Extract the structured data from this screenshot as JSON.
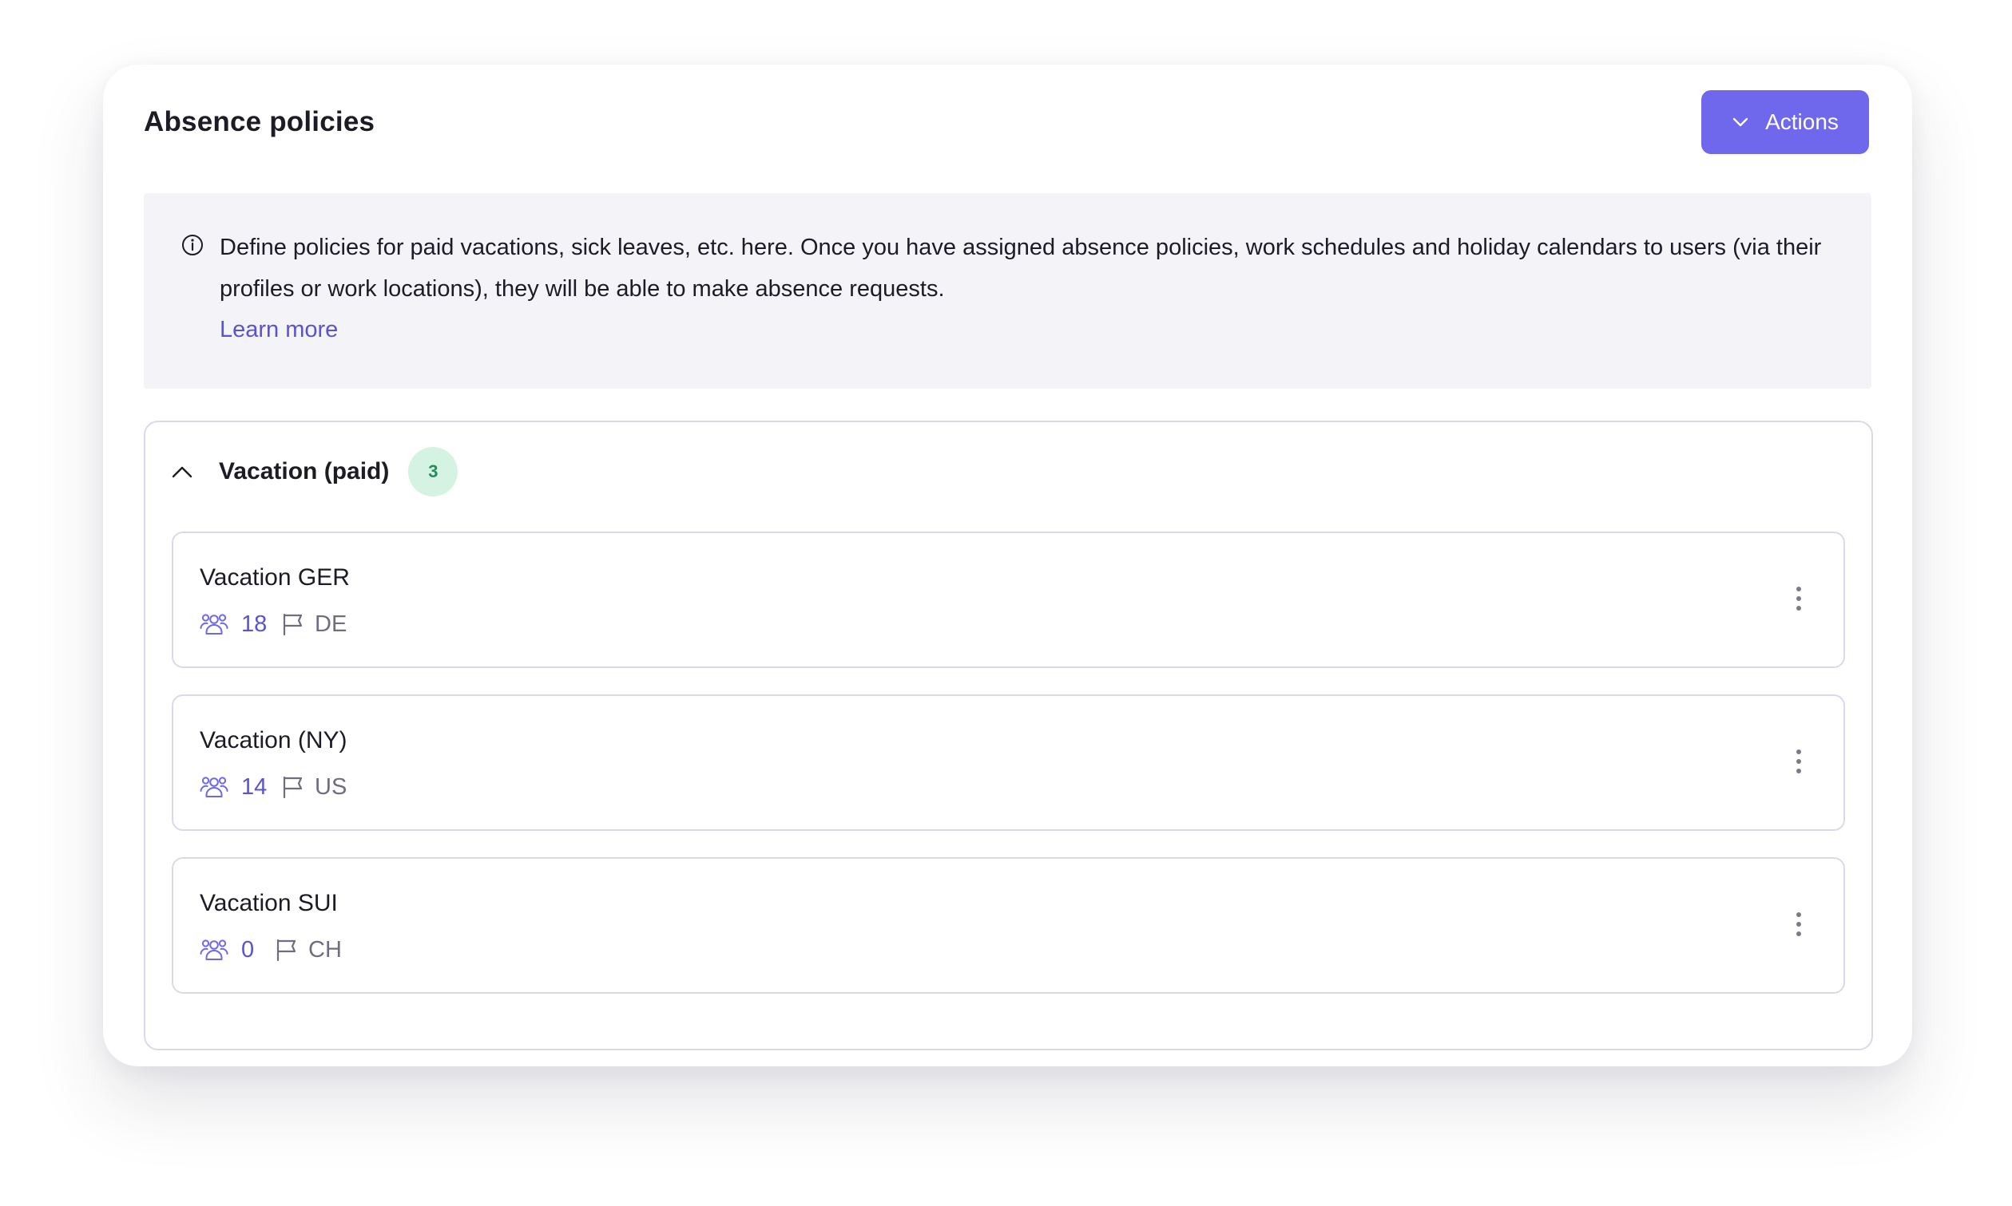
{
  "page": {
    "title": "Absence policies",
    "actions_label": "Actions"
  },
  "info": {
    "text": "Define policies for paid vacations, sick leaves, etc. here. Once you have assigned absence policies, work schedules and holiday calendars to users (via their profiles or work locations), they will be able to make absence requests.",
    "link_label": "Learn more",
    "icon": "info-icon"
  },
  "group": {
    "title": "Vacation (paid)",
    "count": "3",
    "expanded": true
  },
  "policies": [
    {
      "name": "Vacation GER",
      "members": "18",
      "country": "DE"
    },
    {
      "name": "Vacation (NY)",
      "members": "14",
      "country": "US"
    },
    {
      "name": "Vacation SUI",
      "members": "0",
      "country": "CH"
    }
  ],
  "colors": {
    "accent": "#6f67ec",
    "link": "#5a52d6",
    "badge_bg": "#d4f3e2",
    "badge_text": "#2b8a5b",
    "info_bg": "#f4f4f8",
    "border": "#d9d9ee"
  },
  "icons": {
    "people": "people-icon",
    "flag": "flag-icon",
    "more": "more-vertical-icon",
    "chevron_up": "chevron-up-icon",
    "chevron_down": "chevron-down-icon"
  }
}
